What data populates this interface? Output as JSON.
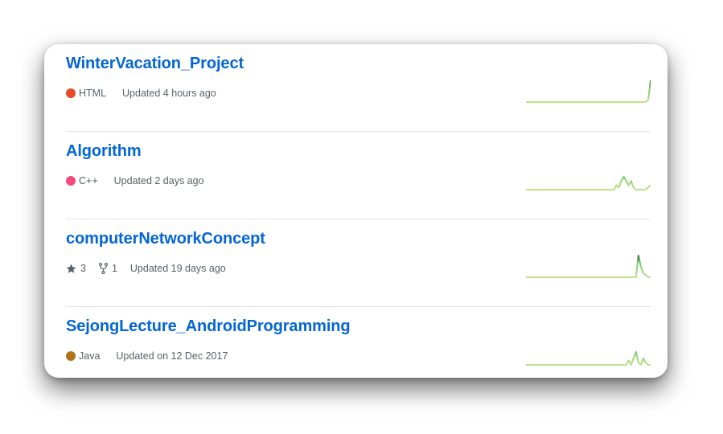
{
  "repos": [
    {
      "name": "WinterVacation_Project",
      "language": "HTML",
      "language_color": "#e34c26",
      "updated": "Updated 4 hours ago",
      "activity": [
        0,
        0,
        0,
        0,
        0,
        0,
        0,
        0,
        0,
        0,
        0,
        0,
        0,
        0,
        0,
        0,
        0,
        0,
        0,
        0,
        0,
        0,
        0,
        0,
        0,
        0,
        0,
        0,
        0,
        0,
        0,
        0,
        0,
        0,
        0,
        0,
        0,
        0,
        0,
        0,
        0,
        0,
        0,
        0,
        0,
        0,
        0,
        0,
        0,
        0,
        1,
        10
      ]
    },
    {
      "name": "Algorithm",
      "language": "C++",
      "language_color": "#f34b7d",
      "updated": "Updated 2 days ago",
      "activity": [
        0,
        0,
        0,
        0,
        0,
        0,
        0,
        0,
        0,
        0,
        0,
        0,
        0,
        0,
        0,
        0,
        0,
        0,
        0,
        0,
        0,
        0,
        0,
        0,
        0,
        0,
        0,
        0,
        0,
        0,
        0,
        0,
        0,
        0,
        0,
        0,
        0,
        2,
        1,
        4,
        6,
        4,
        2,
        4,
        1,
        0,
        0,
        0,
        0,
        0,
        1,
        2
      ]
    },
    {
      "name": "computerNetworkConcept",
      "stars": "3",
      "forks": "1",
      "updated": "Updated 19 days ago",
      "activity": [
        0,
        0,
        0,
        0,
        0,
        0,
        0,
        0,
        0,
        0,
        0,
        0,
        0,
        0,
        0,
        0,
        0,
        0,
        0,
        0,
        0,
        0,
        0,
        0,
        0,
        0,
        0,
        0,
        0,
        0,
        0,
        0,
        0,
        0,
        0,
        0,
        0,
        0,
        0,
        0,
        0,
        0,
        0,
        0,
        0,
        0,
        10,
        5,
        2,
        1,
        0,
        0
      ]
    },
    {
      "name": "SejongLecture_AndroidProgramming",
      "language": "Java",
      "language_color": "#b07219",
      "updated": "Updated on 12 Dec 2017",
      "activity": [
        0,
        0,
        0,
        0,
        0,
        0,
        0,
        0,
        0,
        0,
        0,
        0,
        0,
        0,
        0,
        0,
        0,
        0,
        0,
        0,
        0,
        0,
        0,
        0,
        0,
        0,
        0,
        0,
        0,
        0,
        0,
        0,
        0,
        0,
        0,
        0,
        0,
        0,
        0,
        0,
        0,
        0,
        2,
        0,
        3,
        6,
        1,
        0,
        3,
        1,
        0,
        0
      ]
    }
  ],
  "colors": {
    "link": "#0366d6",
    "spark_light": "#c6e48b",
    "spark_dark": "#196127"
  }
}
